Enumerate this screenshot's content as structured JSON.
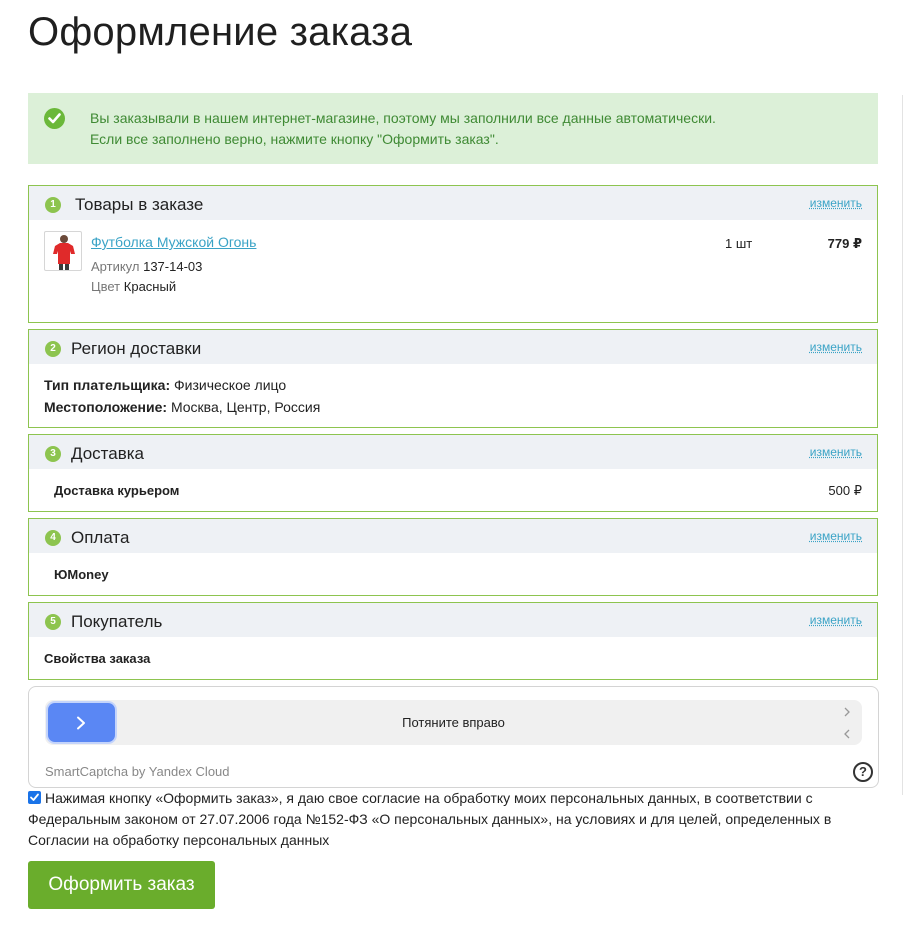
{
  "page": {
    "title": "Оформление заказа"
  },
  "notice": {
    "icon": "check-circle-icon",
    "line1": "Вы заказывали в нашем интернет-магазине, поэтому мы заполнили все данные автоматически.",
    "line2": "Если все заполнено верно, нажмите кнопку \"Оформить заказ\"."
  },
  "sections": {
    "goods": {
      "number": "1",
      "title": "Товары в заказе",
      "edit_label": "изменить",
      "item": {
        "name": "Футболка Мужской Огонь",
        "article_label": "Артикул",
        "article_value": "137-14-03",
        "color_label": "Цвет",
        "color_value": "Красный",
        "quantity": "1 шт",
        "price": "779 ₽"
      }
    },
    "region": {
      "number": "2",
      "title": "Регион доставки",
      "edit_label": "изменить",
      "payer_type_label": "Тип плательщика:",
      "payer_type_value": "Физическое лицо",
      "location_label": "Местоположение:",
      "location_value": "Москва, Центр, Россия"
    },
    "delivery": {
      "number": "3",
      "title": "Доставка",
      "edit_label": "изменить",
      "method": "Доставка курьером",
      "price": "500 ₽"
    },
    "payment": {
      "number": "4",
      "title": "Оплата",
      "edit_label": "изменить",
      "method": "ЮMoney"
    },
    "buyer": {
      "number": "5",
      "title": "Покупатель",
      "edit_label": "изменить",
      "properties_label": "Свойства заказа"
    }
  },
  "captcha": {
    "slider_label": "Потяните вправо",
    "brand": "SmartCaptcha by Yandex Cloud",
    "help_label": "?"
  },
  "consent": {
    "checked": true,
    "text": "Нажимая кнопку «Оформить заказ», я даю свое согласие на обработку моих персональных данных, в соответствии с Федеральным законом от 27.07.2006 года №152-ФЗ «О персональных данных», на условиях и для целей, определенных в Согласии на обработку персональных данных"
  },
  "submit": {
    "label": "Оформить заказ"
  },
  "colors": {
    "accent_green": "#6aad2c",
    "section_border": "#8dc44f",
    "link_blue": "#3aa3c6",
    "notice_bg": "#dcf0d8",
    "captcha_blue": "#5a87f4"
  }
}
